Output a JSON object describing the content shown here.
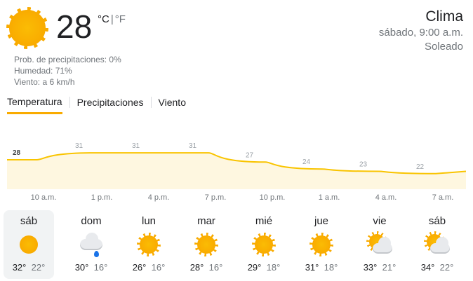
{
  "current": {
    "temp": "28",
    "unit_c": "°C",
    "unit_sep": "|",
    "unit_f": "°F",
    "precip": "Prob. de precipitaciones: 0%",
    "humidity": "Humedad: 71%",
    "wind": "Viento: a 6 km/h",
    "icon": "sun-icon"
  },
  "header": {
    "title": "Clima",
    "datetime": "sábado, 9:00 a.m.",
    "condition": "Soleado"
  },
  "tabs": [
    {
      "label": "Temperatura",
      "active": true
    },
    {
      "label": "Precipitaciones",
      "active": false
    },
    {
      "label": "Viento",
      "active": false
    }
  ],
  "chart_data": {
    "type": "area",
    "x": [
      "10 a.m.",
      "1 p.m.",
      "4 p.m.",
      "7 p.m.",
      "10 p.m.",
      "1 a.m.",
      "4 a.m.",
      "7 a.m."
    ],
    "values": [
      28,
      31,
      31,
      31,
      27,
      24,
      23,
      22
    ],
    "colors": {
      "line": "#f9c400",
      "fill": "#fef7e0"
    }
  },
  "days": [
    {
      "name": "sáb",
      "high": "32°",
      "low": "22°",
      "icon": "sun-icon",
      "selected": true
    },
    {
      "name": "dom",
      "high": "30°",
      "low": "16°",
      "icon": "rain-icon",
      "selected": false
    },
    {
      "name": "lun",
      "high": "26°",
      "low": "16°",
      "icon": "sun-icon",
      "selected": false
    },
    {
      "name": "mar",
      "high": "28°",
      "low": "16°",
      "icon": "sun-icon",
      "selected": false
    },
    {
      "name": "mié",
      "high": "29°",
      "low": "18°",
      "icon": "sun-icon",
      "selected": false
    },
    {
      "name": "jue",
      "high": "31°",
      "low": "18°",
      "icon": "sun-icon",
      "selected": false
    },
    {
      "name": "vie",
      "high": "33°",
      "low": "21°",
      "icon": "partly-cloudy-icon",
      "selected": false
    },
    {
      "name": "sáb",
      "high": "34°",
      "low": "22°",
      "icon": "partly-cloudy-icon",
      "selected": false
    }
  ]
}
